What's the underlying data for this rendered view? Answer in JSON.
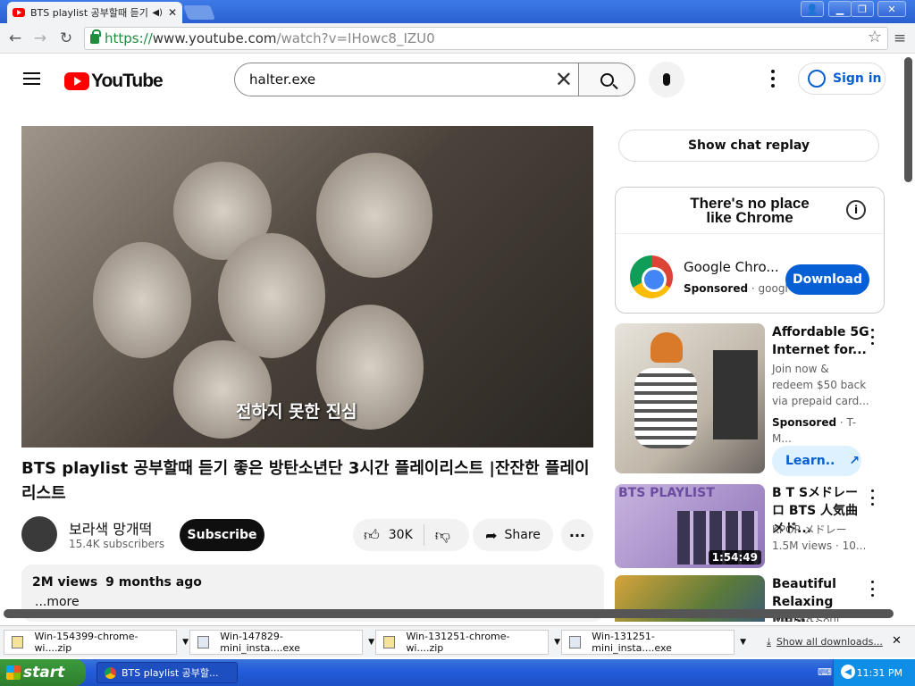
{
  "browser": {
    "tab_title": "BTS playlist 공부할때 듣기",
    "url_scheme": "https://",
    "url_host": "www.youtube.com",
    "url_path": "/watch?v=IHowc8_IZU0"
  },
  "youtube": {
    "logo_text": "YouTube",
    "search_value": "halter.exe",
    "sign_in": "Sign in",
    "video": {
      "caption": "전하지 못한 진심",
      "title": "BTS playlist 공부할때 듣기 좋은 방탄소년단 3시간 플레이리스트 |잔잔한 플레이리스트",
      "channel_name": "보라색 망개떡",
      "subscribers": "15.4K subscribers",
      "subscribe": "Subscribe",
      "likes": "30K",
      "share": "Share",
      "views": "2M views",
      "age": "9 months ago",
      "more": "...more"
    },
    "sidebar": {
      "chat_replay": "Show chat replay",
      "ad_banner": "There's no place like Chrome",
      "ad_name": "Google Chro...",
      "ad_sponsored": "Sponsored",
      "ad_domain": "googl",
      "ad_download": "Download",
      "recs": [
        {
          "title": "Affordable 5G Internet for...",
          "sub": "Join now & redeem $50 back via prepaid card...",
          "meta": "Sponsored",
          "meta2": "T-M...",
          "button": "Learn.."
        },
        {
          "title": "B T Sメドレーロ BTS 人気曲 メド...",
          "sub": "KPOP メドレー",
          "meta": "1.5M views",
          "meta2": "10...",
          "duration": "1:54:49",
          "thumb_text": "BTS PLAYLIST"
        },
        {
          "title": "Beautiful Relaxing Musi...",
          "sub": "Healing Soul..."
        }
      ]
    }
  },
  "downloads": {
    "items": [
      "Win-154399-chrome-wi....zip",
      "Win-147829-mini_insta....exe",
      "Win-131251-chrome-wi....zip",
      "Win-131251-mini_insta....exe"
    ],
    "show_all": "Show all downloads..."
  },
  "taskbar": {
    "start": "start",
    "item": "BTS playlist 공부할...",
    "clock": "11:31 PM"
  }
}
